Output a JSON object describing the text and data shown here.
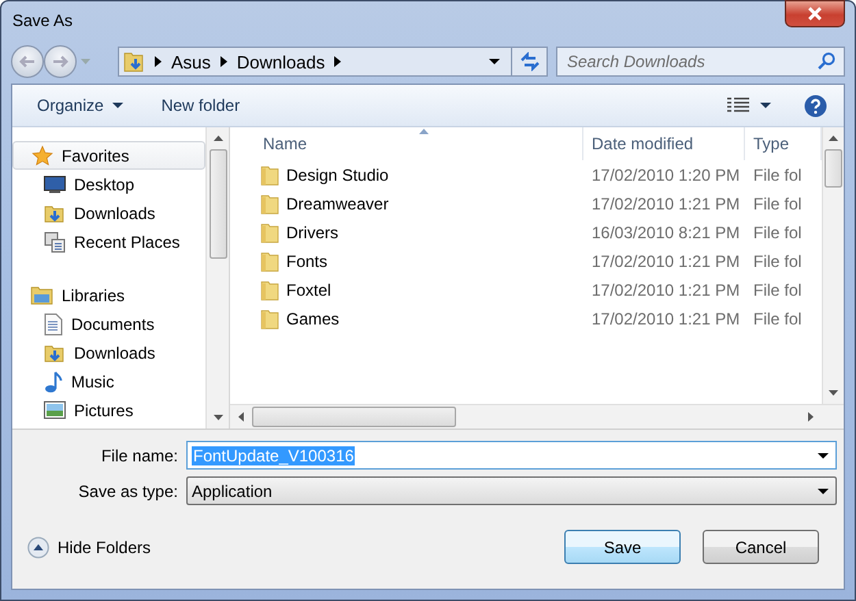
{
  "window": {
    "title": "Save As"
  },
  "address": {
    "path": [
      "Asus",
      "Downloads"
    ]
  },
  "search": {
    "placeholder": "Search Downloads"
  },
  "toolbar": {
    "organize": "Organize",
    "new_folder": "New folder"
  },
  "sidebar": {
    "groups": [
      {
        "label": "Favorites",
        "kind": "favorites",
        "selected": true,
        "children": [
          {
            "label": "Desktop",
            "kind": "desktop",
            "selected": false
          },
          {
            "label": "Downloads",
            "kind": "downloads",
            "selected": false
          },
          {
            "label": "Recent Places",
            "kind": "recent",
            "selected": false
          }
        ]
      },
      {
        "label": "Libraries",
        "kind": "libraries",
        "selected": false,
        "children": [
          {
            "label": "Documents",
            "kind": "documents",
            "selected": false
          },
          {
            "label": "Downloads",
            "kind": "downloads",
            "selected": false
          },
          {
            "label": "Music",
            "kind": "music",
            "selected": false
          },
          {
            "label": "Pictures",
            "kind": "pictures",
            "selected": false
          }
        ]
      }
    ]
  },
  "table": {
    "columns": [
      "Name",
      "Date modified",
      "Type"
    ],
    "rows": [
      {
        "name": "Design Studio",
        "date": "17/02/2010 1:20 PM",
        "type": "File fol"
      },
      {
        "name": "Dreamweaver",
        "date": "17/02/2010 1:21 PM",
        "type": "File fol"
      },
      {
        "name": "Drivers",
        "date": "16/03/2010 8:21 PM",
        "type": "File fol"
      },
      {
        "name": "Fonts",
        "date": "17/02/2010 1:21 PM",
        "type": "File fol"
      },
      {
        "name": "Foxtel",
        "date": "17/02/2010 1:21 PM",
        "type": "File fol"
      },
      {
        "name": "Games",
        "date": "17/02/2010 1:21 PM",
        "type": "File fol"
      }
    ]
  },
  "form": {
    "file_name_label": "File name:",
    "file_name": "FontUpdate_V100316",
    "type_label": "Save as type:",
    "type": "Application"
  },
  "hide_folders": "Hide Folders",
  "buttons": [
    "Save",
    "Cancel"
  ]
}
